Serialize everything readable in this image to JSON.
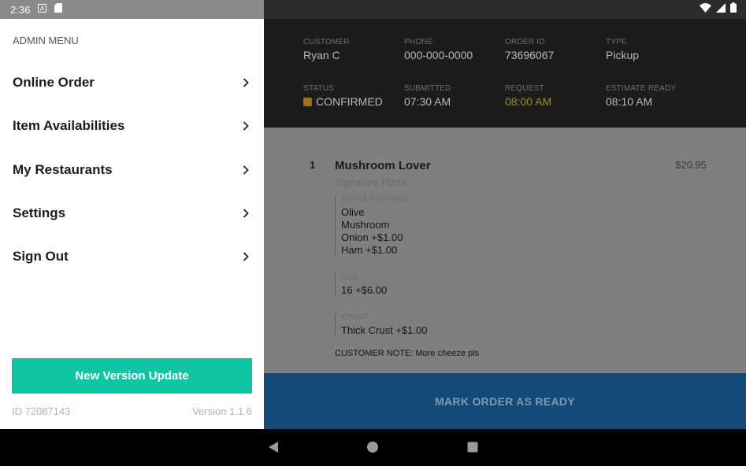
{
  "status_bar": {
    "time": "2:36",
    "icons_left": [
      "a-notification-icon",
      "sd-card-icon"
    ],
    "icons_right": [
      "wifi-icon",
      "signal-icon",
      "battery-icon"
    ]
  },
  "drawer": {
    "title": "ADMIN MENU",
    "items": [
      {
        "label": "Online Order"
      },
      {
        "label": "Item Availabilities"
      },
      {
        "label": "My Restaurants"
      },
      {
        "label": "Settings"
      },
      {
        "label": "Sign Out"
      }
    ],
    "update_button": "New Version Update",
    "device_id": "ID 72087143",
    "version": "Version 1.1.6"
  },
  "order": {
    "customer_label": "CUSTOMER",
    "customer": "Ryan C",
    "phone_label": "PHONE",
    "phone": "000-000-0000",
    "order_id_label": "ORDER ID",
    "order_id": "73696067",
    "type_label": "TYPE",
    "type": "Pickup",
    "status_label": "STATUS",
    "status": "CONFIRMED",
    "submitted_label": "SUBMITTED",
    "submitted": "07:30 AM",
    "request_label": "REQUEST",
    "request": "08:00 AM",
    "estimate_label": "ESTIMATE READY",
    "estimate": "08:10 AM",
    "item": {
      "qty": "1",
      "name": "Mushroom Lover",
      "category": "Signature Pizza",
      "price": "$20.95",
      "modifiers": [
        {
          "label": "EXTRA TOPPINGS",
          "values": [
            "Olive",
            "Mushroom",
            "Onion +$1.00",
            "Ham +$1.00"
          ]
        },
        {
          "label": "SIZE",
          "values": [
            "16 +$6.00"
          ]
        },
        {
          "label": "CRUST",
          "values": [
            "Thick Crust +$1.00"
          ]
        }
      ],
      "note": "CUSTOMER NOTE: More cheeze pls"
    },
    "ready_button": "MARK ORDER AS READY"
  },
  "colors": {
    "accent_green": "#10c5a4",
    "status_confirmed": "#e39f24",
    "request_highlight": "#e2d13a",
    "ready_blue": "#1677cc"
  }
}
